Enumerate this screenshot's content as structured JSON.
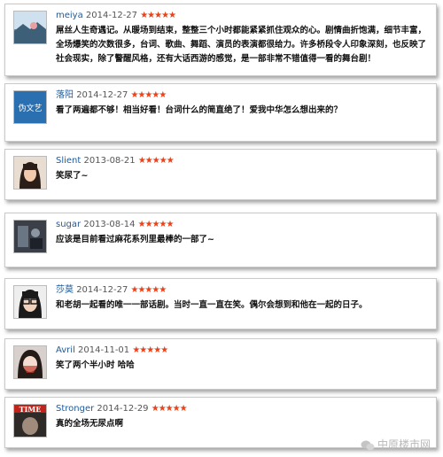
{
  "comments": [
    {
      "user": "meiya",
      "date": "2014-12-27",
      "stars": "★★★★★",
      "text": "屌丝人生奇遇记。从暖场到结束，整整三个小时都能紧紧抓住观众的心。剧情曲折饱满，细节丰富，全场爆笑的次数很多，台词、歌曲、舞蹈、演员的表演都很给力。许多桥段令人印象深刻，也反映了社会现实，除了警醒风格，还有大话西游的感觉，是一部非常不错值得一看的舞台剧！",
      "avatar": "landscape"
    },
    {
      "user": "落阳",
      "date": "2014-12-27",
      "stars": "★★★★★",
      "text": "看了两遍都不够！相当好看！台词什么的简直绝了！爱我中华怎么想出来的？",
      "avatar": "伪文艺"
    },
    {
      "user": "Slient",
      "date": "2013-08-21",
      "stars": "★★★★★",
      "text": "笑尿了~",
      "avatar": "girl"
    },
    {
      "user": "sugar",
      "date": "2013-08-14",
      "stars": "★★★★★",
      "text": "应该是目前看过麻花系列里最棒的一部了~",
      "avatar": "dark-scene"
    },
    {
      "user": "莎莫",
      "date": "2014-12-27",
      "stars": "★★★★★",
      "text": "和老胡一起看的唯一一部话剧。当时一直一直在笑。偶尔会想到和他在一起的日子。",
      "avatar": "glasses-girl"
    },
    {
      "user": "Avril",
      "date": "2014-11-01",
      "stars": "★★★★★",
      "text": "笑了两个半小时 哈哈",
      "avatar": "doll"
    },
    {
      "user": "Stronger",
      "date": "2014-12-29",
      "stars": "★★★★★",
      "text": "真的全场无尿点啊",
      "avatar": "TIME"
    }
  ],
  "watermark": "中原楼市网",
  "colors": {
    "username": "#1d5a9c",
    "stars": "#e4431c",
    "avatar_text_bg": "#2a6fb0"
  }
}
